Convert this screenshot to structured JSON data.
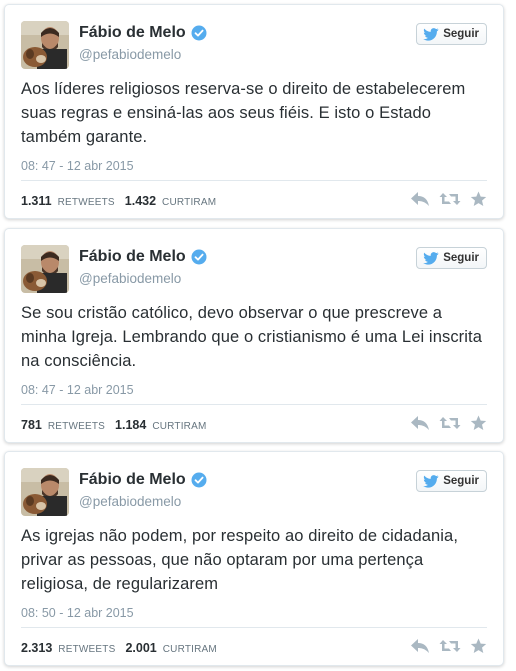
{
  "colors": {
    "text": "#292f33",
    "muted": "#8899a6",
    "verified": "#55acee",
    "twitter_blue": "#55acee",
    "action_icon": "#aab8c2",
    "border": "#e1e8ed"
  },
  "tweets": [
    {
      "author": {
        "name": "Fábio de Melo",
        "handle": "@pefabiodemelo",
        "verified_icon": "verified-badge-icon",
        "avatar_icon": "avatar"
      },
      "follow_label": "Seguir",
      "text": "Aos líderes religiosos reserva-se o direito de estabelecerem suas regras e ensiná-las aos seus fiéis. E isto o Estado também garante.",
      "timestamp": "08: 47 - 12 abr 2015",
      "retweets": "1.311",
      "retweets_label": "RETWEETS",
      "likes": "1.432",
      "likes_label": "CURTIRAM"
    },
    {
      "author": {
        "name": "Fábio de Melo",
        "handle": "@pefabiodemelo",
        "verified_icon": "verified-badge-icon",
        "avatar_icon": "avatar"
      },
      "follow_label": "Seguir",
      "text": "Se sou cristão católico, devo observar o que prescreve a minha Igreja. Lembrando que o cristianismo é uma Lei inscrita na consciência.",
      "timestamp": "08: 47 - 12 abr 2015",
      "retweets": "781",
      "retweets_label": "RETWEETS",
      "likes": "1.184",
      "likes_label": "CURTIRAM"
    },
    {
      "author": {
        "name": "Fábio de Melo",
        "handle": "@pefabiodemelo",
        "verified_icon": "verified-badge-icon",
        "avatar_icon": "avatar"
      },
      "follow_label": "Seguir",
      "text": "As igrejas não podem, por respeito ao direito de cidadania, privar as pessoas, que não optaram por uma pertença religiosa, de regularizarem",
      "timestamp": "08: 50 - 12 abr 2015",
      "retweets": "2.313",
      "retweets_label": "RETWEETS",
      "likes": "2.001",
      "likes_label": "CURTIRAM"
    }
  ],
  "action_icons": [
    "reply-icon",
    "retweet-icon",
    "favorite-star-icon"
  ]
}
